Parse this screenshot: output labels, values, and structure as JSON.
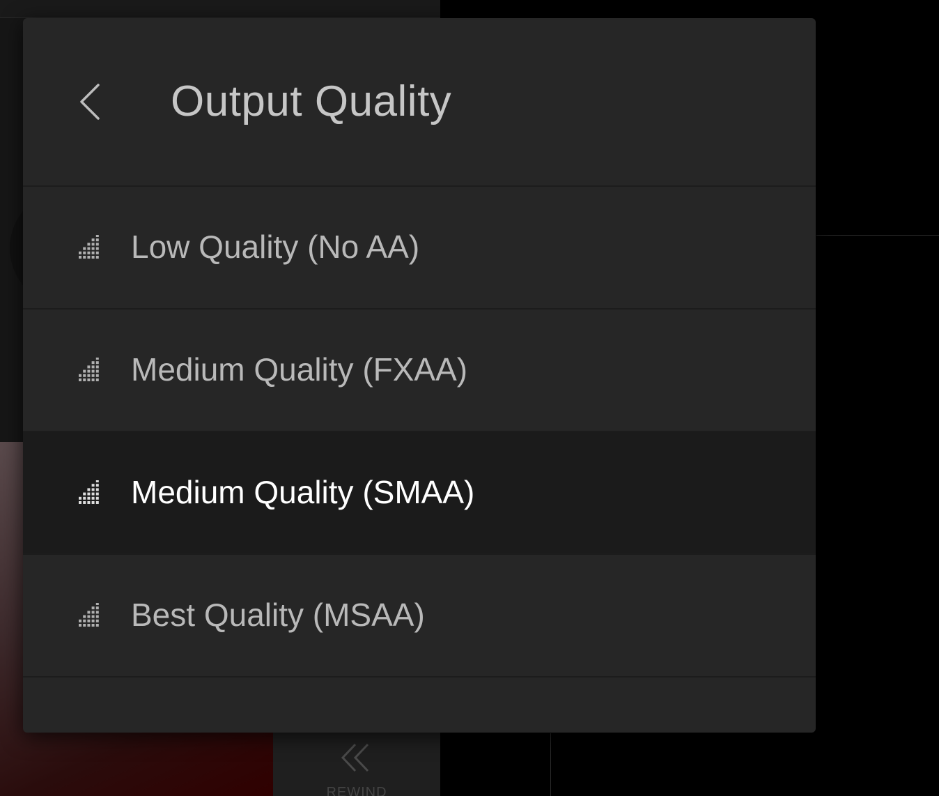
{
  "background": {
    "rewind_label": "REWIND"
  },
  "panel": {
    "title": "Output Quality",
    "back_icon": "chevron-left-icon",
    "options": [
      {
        "label": "Low Quality (No AA)",
        "icon": "signal-bars-icon",
        "selected": false
      },
      {
        "label": "Medium Quality (FXAA)",
        "icon": "signal-bars-icon",
        "selected": false
      },
      {
        "label": "Medium Quality (SMAA)",
        "icon": "signal-bars-icon",
        "selected": true
      },
      {
        "label": "Best Quality (MSAA)",
        "icon": "signal-bars-icon",
        "selected": false
      }
    ]
  },
  "colors": {
    "panel_bg": "#262626",
    "selected_row_bg": "#1b1b1b",
    "text_default": "#b9b9b9",
    "text_selected": "#ffffff"
  }
}
